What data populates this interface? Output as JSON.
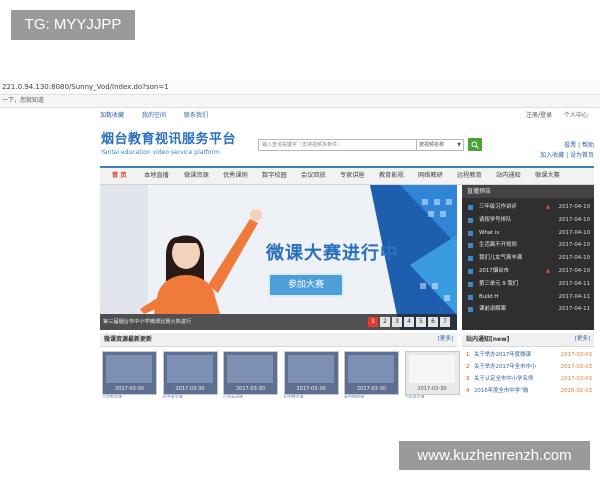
{
  "overlay_tag": "TG: MYYJJPP",
  "browser": {
    "address": "221.0.94.130:8080/Sunny_Vod/Index.do?son=1",
    "notice_bar": "一下，您就知道"
  },
  "top_links": {
    "left": [
      "加数收藏",
      "我的空间",
      "联系我们"
    ],
    "right": [
      "注册/登录",
      "个人中心"
    ]
  },
  "logo": {
    "title": "烟台教育视讯服务平台",
    "subtitle": "Yantai education video service platform"
  },
  "search": {
    "placeholder": "输入查询关键字（支持视频多条件）",
    "select_value": "按视频名称",
    "select_arrow": "▼",
    "button_icon": "search-icon"
  },
  "right_links": {
    "row1": "投票 | 帮助",
    "row2": "加入收藏 | 设为首页"
  },
  "nav": [
    "首 页",
    "本地直播",
    "微课资源",
    "优秀课例",
    "数字校园",
    "会议回放",
    "专家讲座",
    "教育影视",
    "网络教研",
    "远程教育",
    "站内通知",
    "微课大赛"
  ],
  "banner": {
    "title": "微课大赛进行中",
    "button": "参加大赛",
    "caption": "第三届烟台市中小学微课比赛火热进行",
    "pages": [
      "1",
      "2",
      "3",
      "4",
      "5",
      "6",
      "7"
    ],
    "active_page": 1
  },
  "announcements": {
    "heading": "直播预告",
    "items": [
      {
        "title": "三年级习作讲评",
        "hot": true,
        "date": "2017-04-10"
      },
      {
        "title": "请按学号排队",
        "hot": false,
        "date": "2017-04-10"
      },
      {
        "title": "What is",
        "hot": false,
        "date": "2017-04-10"
      },
      {
        "title": "生活离不开规则",
        "hot": false,
        "date": "2017-04-10"
      },
      {
        "title": "我们儿女气爽丰满",
        "hot": false,
        "date": "2017-04-10"
      },
      {
        "title": "2017烟台市",
        "hot": true,
        "date": "2017-04-10"
      },
      {
        "title": "第三单元 9 我们",
        "hot": false,
        "date": "2017-04-11"
      },
      {
        "title": "Build H",
        "hot": false,
        "date": "2017-04-11"
      },
      {
        "title": "课前讲解案",
        "hot": false,
        "date": "2017-04-11"
      }
    ]
  },
  "recent_videos": {
    "heading": "微课资源最新更新",
    "more": "[更多]",
    "items": [
      {
        "date": "2017-03-30",
        "caption": "小学数学课"
      },
      {
        "date": "2017-03-30",
        "caption": "初中语文课"
      },
      {
        "date": "2017-03-30",
        "caption": "小学英语课"
      },
      {
        "date": "2017-03-30",
        "caption": "初中数学课"
      },
      {
        "date": "2017-03-30",
        "caption": "高中物理课"
      },
      {
        "date": "2017-03-30",
        "caption": "小学语文课"
      }
    ]
  },
  "site_notice": {
    "heading": "站内通知[new]",
    "more": "[更多]",
    "items": [
      {
        "n": "1",
        "title": "关于举办2017年度微课",
        "date": "2017-03-03"
      },
      {
        "n": "2",
        "title": "关于举办2017年全市中小",
        "date": "2017-03-03"
      },
      {
        "n": "3",
        "title": "关于认定全市中小学名师",
        "date": "2017-03-03"
      },
      {
        "n": "4",
        "title": "2016年度全市中学“融",
        "date": "2016-02-03"
      }
    ]
  },
  "watermark": "www.kuzhenrenzh.com",
  "colors": {
    "brand_blue": "#2b6fbf",
    "nav_accent": "#3a7fc3",
    "hot_red": "#ff4b3a",
    "search_green": "#4aa336",
    "panel_dark": "#2f2f2f"
  }
}
